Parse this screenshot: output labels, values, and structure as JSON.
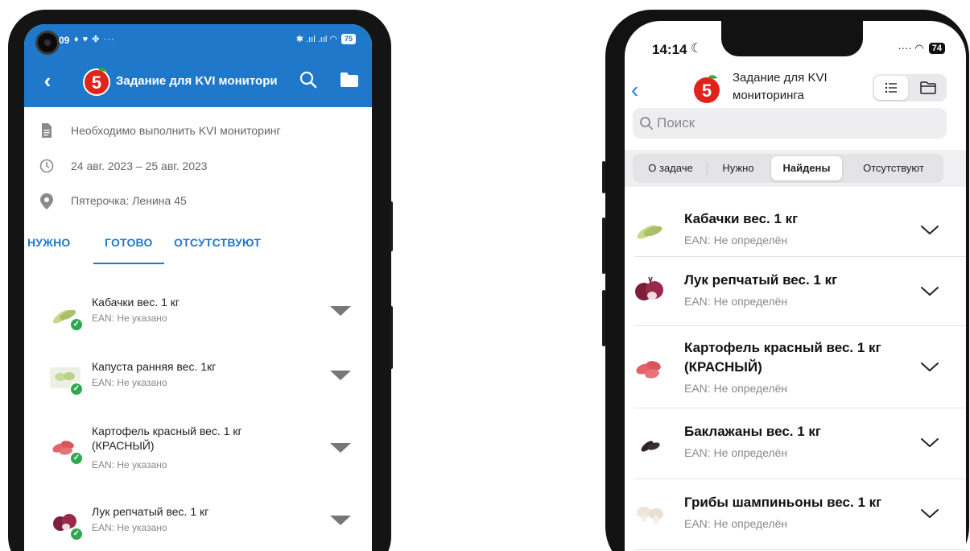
{
  "android": {
    "status": {
      "time": "09",
      "icons_left": "♦ ♥ ✤ ···",
      "signal": "✱ .ııl .ııl ◠",
      "battery": "75"
    },
    "appbar": {
      "title": "Задание для KVI монитори"
    },
    "info": {
      "description": "Необходимо выполнить KVI мониторинг",
      "dates": "24 авг. 2023 – 25 авг. 2023",
      "store": "Пятерочка: Ленина 45"
    },
    "tabs": [
      {
        "label": "НУЖНО"
      },
      {
        "label": "ГОТОВО"
      },
      {
        "label": "ОТСУТСТВУЮТ"
      }
    ],
    "items": [
      {
        "title": "Кабачки вес. 1 кг",
        "ean": "EAN: Не указано"
      },
      {
        "title": "Капуста ранняя вес. 1кг",
        "ean": "EAN: Не указано"
      },
      {
        "title": "Картофель красный вес. 1 кг (КРАСНЫЙ)",
        "ean": "EAN: Не указано"
      },
      {
        "title": "Лук репчатый вес. 1 кг",
        "ean": "EAN: Не указано"
      }
    ]
  },
  "ios": {
    "status": {
      "time": "14:14",
      "battery": "74",
      "signal": "···· ◠"
    },
    "header": {
      "title": "Задание для KVI мониторинга"
    },
    "search": {
      "placeholder": "Поиск"
    },
    "tabs": [
      {
        "label": "О задаче"
      },
      {
        "label": "Нужно"
      },
      {
        "label": "Найдены"
      },
      {
        "label": "Отсутствуют"
      }
    ],
    "items": [
      {
        "title": "Кабачки вес. 1 кг",
        "ean": "EAN: Не определён"
      },
      {
        "title": "Лук репчатый вес. 1 кг",
        "ean": "EAN: Не определён"
      },
      {
        "title": "Картофель красный вес. 1 кг (КРАСНЫЙ)",
        "ean": "EAN: Не определён"
      },
      {
        "title": "Баклажаны вес. 1 кг",
        "ean": "EAN: Не определён"
      },
      {
        "title": "Грибы шампиньоны вес. 1 кг",
        "ean": "EAN: Не определён"
      }
    ]
  },
  "colors": {
    "android_primary": "#1f78c9",
    "ios_accent": "#2a7de1",
    "brand_red": "#e2231a",
    "brand_green": "#3aaa35",
    "check_green": "#2fa84f"
  },
  "icons": {
    "android": [
      "back-icon",
      "logo-icon",
      "search-icon",
      "folder-icon",
      "document-icon",
      "clock-icon",
      "location-pin-icon",
      "check-icon",
      "caret-down-icon"
    ],
    "ios": [
      "back-chevron-icon",
      "logo-icon",
      "list-icon",
      "folder-icon",
      "search-icon",
      "chevron-down-icon"
    ]
  }
}
